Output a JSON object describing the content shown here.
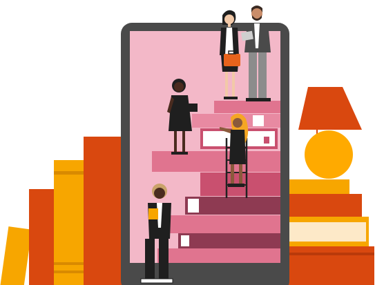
{
  "illustration": {
    "palette": {
      "tablet_frame": "#4a4a4a",
      "tablet_screen": "#f3b8c8",
      "book_pink": "#e0748f",
      "book_dark": "#8e3a52",
      "book_orange": "#d9480f",
      "book_yellow": "#f7a600",
      "book_cream": "#fde9c8",
      "lamp_shade": "#d9480f",
      "lamp_base": "#ffaa00",
      "skin_dark": "#4a2b1f",
      "skin_medium": "#8a5a3c",
      "skin_light": "#f2c9a8",
      "hair_blonde": "#f5a623",
      "suit_grey": "#8c8c8c",
      "clothing_black": "#1f1f1f",
      "briefcase": "#e8631c"
    },
    "icons": [
      "tablet-icon",
      "book-stack-icon",
      "table-lamp-icon",
      "ladder-icon",
      "person-icon"
    ]
  }
}
